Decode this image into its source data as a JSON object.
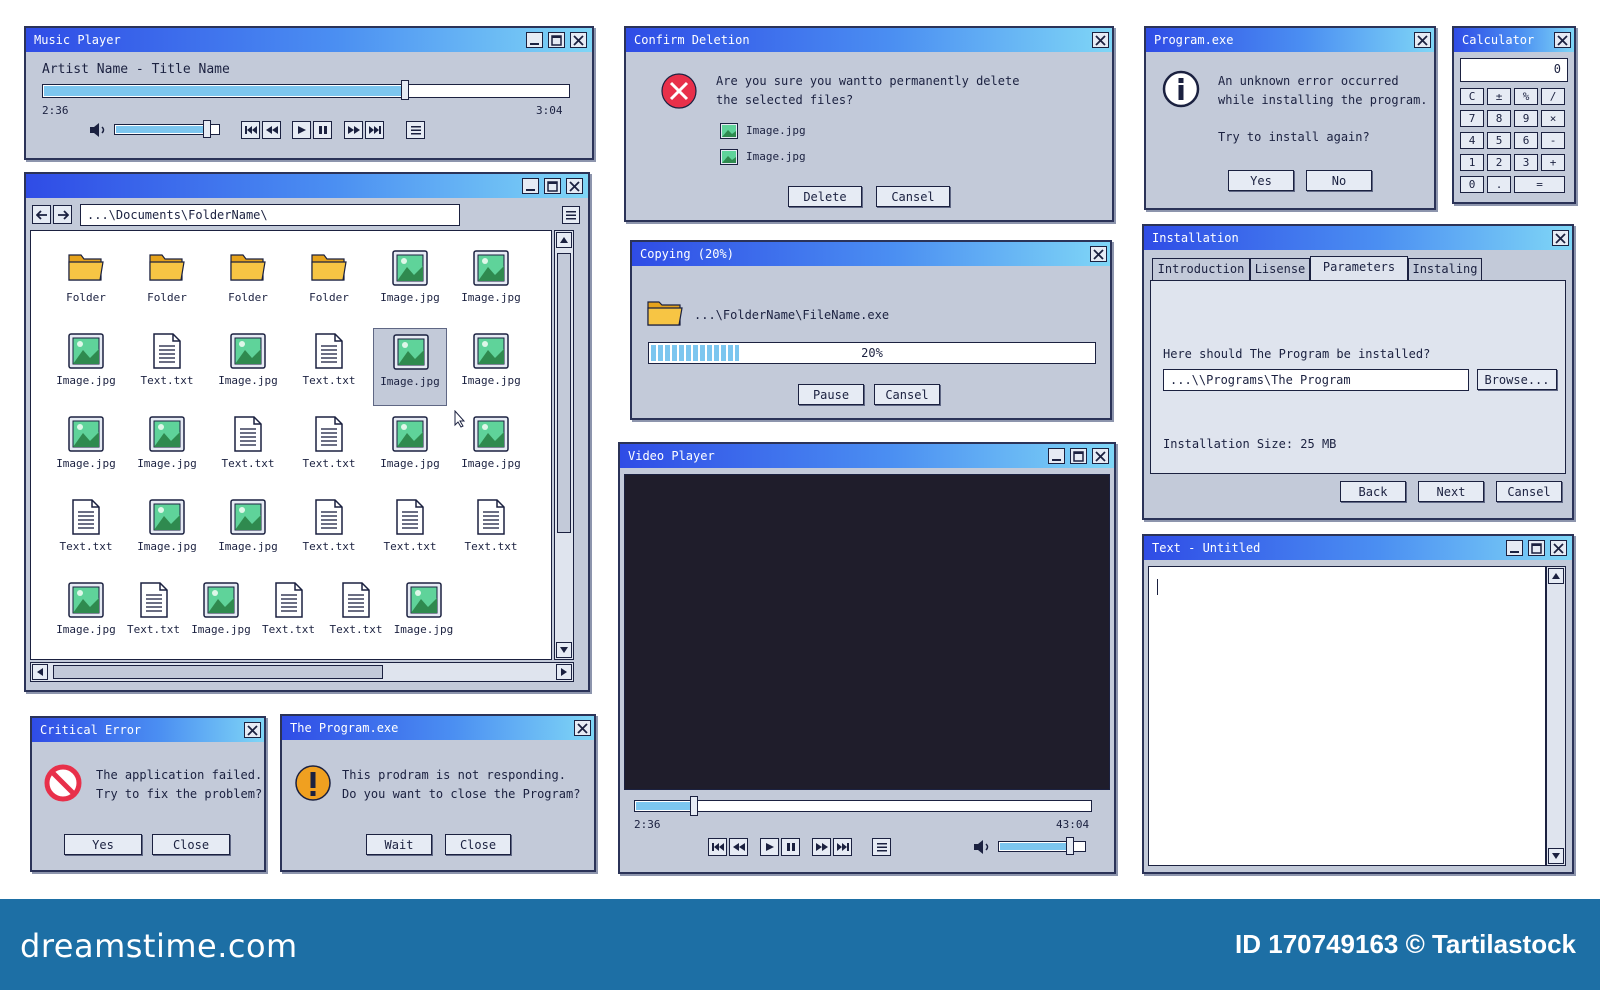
{
  "music_player": {
    "title": "Music Player",
    "track": "Artist Name - Title Name",
    "elapsed": "2:36",
    "duration": "3:04",
    "progress": 0.69,
    "volume": 0.9
  },
  "explorer": {
    "path": "...\\Documents\\FolderName\\",
    "items": [
      {
        "type": "folder",
        "label": "Folder"
      },
      {
        "type": "folder",
        "label": "Folder"
      },
      {
        "type": "folder",
        "label": "Folder"
      },
      {
        "type": "folder",
        "label": "Folder"
      },
      {
        "type": "image",
        "label": "Image.jpg"
      },
      {
        "type": "image",
        "label": "Image.jpg"
      },
      {
        "type": "image",
        "label": "Image.jpg"
      },
      {
        "type": "text",
        "label": "Text.txt"
      },
      {
        "type": "image",
        "label": "Image.jpg"
      },
      {
        "type": "text",
        "label": "Text.txt"
      },
      {
        "type": "image",
        "label": "Image.jpg",
        "selected": true
      },
      {
        "type": "image",
        "label": "Image.jpg"
      },
      {
        "type": "image",
        "label": "Image.jpg"
      },
      {
        "type": "image",
        "label": "Image.jpg"
      },
      {
        "type": "text",
        "label": "Text.txt"
      },
      {
        "type": "text",
        "label": "Text.txt"
      },
      {
        "type": "image",
        "label": "Image.jpg"
      },
      {
        "type": "image",
        "label": "Image.jpg"
      },
      {
        "type": "text",
        "label": "Text.txt"
      },
      {
        "type": "image",
        "label": "Image.jpg"
      },
      {
        "type": "image",
        "label": "Image.jpg"
      },
      {
        "type": "text",
        "label": "Text.txt"
      },
      {
        "type": "text",
        "label": "Text.txt"
      },
      {
        "type": "text",
        "label": "Text.txt"
      },
      {
        "type": "image",
        "label": "Image.jpg"
      },
      {
        "type": "text",
        "label": "Text.txt"
      },
      {
        "type": "image",
        "label": "Image.jpg"
      },
      {
        "type": "text",
        "label": "Text.txt"
      },
      {
        "type": "text",
        "label": "Text.txt"
      },
      {
        "type": "image",
        "label": "Image.jpg"
      }
    ]
  },
  "confirm_deletion": {
    "title": "Confirm Deletion",
    "message_line1": "Are you sure you wantto permanently delete",
    "message_line2": "the selected files?",
    "files": [
      "Image.jpg",
      "Image.jpg"
    ],
    "delete_label": "Delete",
    "cancel_label": "Cansel"
  },
  "copying": {
    "title": "Copying (20%)",
    "path": "...\\FolderName\\FileName.exe",
    "progress": 0.2,
    "progress_text": "20%",
    "pause_label": "Pause",
    "cancel_label": "Cansel"
  },
  "video_player": {
    "title": "Video Player",
    "elapsed": "2:36",
    "duration": "43:04",
    "progress": 0.13,
    "volume": 0.85
  },
  "program_error": {
    "title": "Program.exe",
    "line1": "An unknown error occurred",
    "line2": "while installing the program.",
    "line3": "Try to install again?",
    "yes_label": "Yes",
    "no_label": "No"
  },
  "calculator": {
    "title": "Calculator",
    "display": "0",
    "keys": [
      [
        "C",
        "±",
        "%",
        "/"
      ],
      [
        "7",
        "8",
        "9",
        "×"
      ],
      [
        "4",
        "5",
        "6",
        "-"
      ],
      [
        "1",
        "2",
        "3",
        "+"
      ]
    ],
    "bottom_keys": [
      "0",
      ".",
      "="
    ]
  },
  "installation": {
    "title": "Installation",
    "tabs": [
      "Introduction",
      "Lisense",
      "Parameters",
      "Instaling"
    ],
    "active_tab": "Parameters",
    "question": "Here should The Program be installed?",
    "path_value": "...\\\\Programs\\The Program",
    "browse_label": "Browse...",
    "size_text": "Installation Size: 25 MB",
    "back_label": "Back",
    "next_label": "Next",
    "cancel_label": "Cansel"
  },
  "text_editor": {
    "title": "Text - Untitled"
  },
  "critical_error": {
    "title": "Critical Error",
    "line1": "The application failed.",
    "line2": "Try to fix the problem?",
    "yes_label": "Yes",
    "close_label": "Close"
  },
  "not_responding": {
    "title": "The Program.exe",
    "line1": "This prodram is not responding.",
    "line2": "Do you want to close the Program?",
    "wait_label": "Wait",
    "close_label": "Close"
  },
  "footer": {
    "brand": "dreamstime.com",
    "credit": "ID 170749163 © Tartilastock"
  },
  "colors": {
    "titlebar_start": "#2f4ce6",
    "titlebar_end": "#7fd6f6",
    "window_body": "#c3cad9",
    "border": "#2b3358",
    "progress_fill": "#7cc6ef",
    "video_screen": "#1f1d2b",
    "error_red": "#e8304a",
    "warning_orange": "#f0a020",
    "footer_bg": "#1d6fa5"
  }
}
